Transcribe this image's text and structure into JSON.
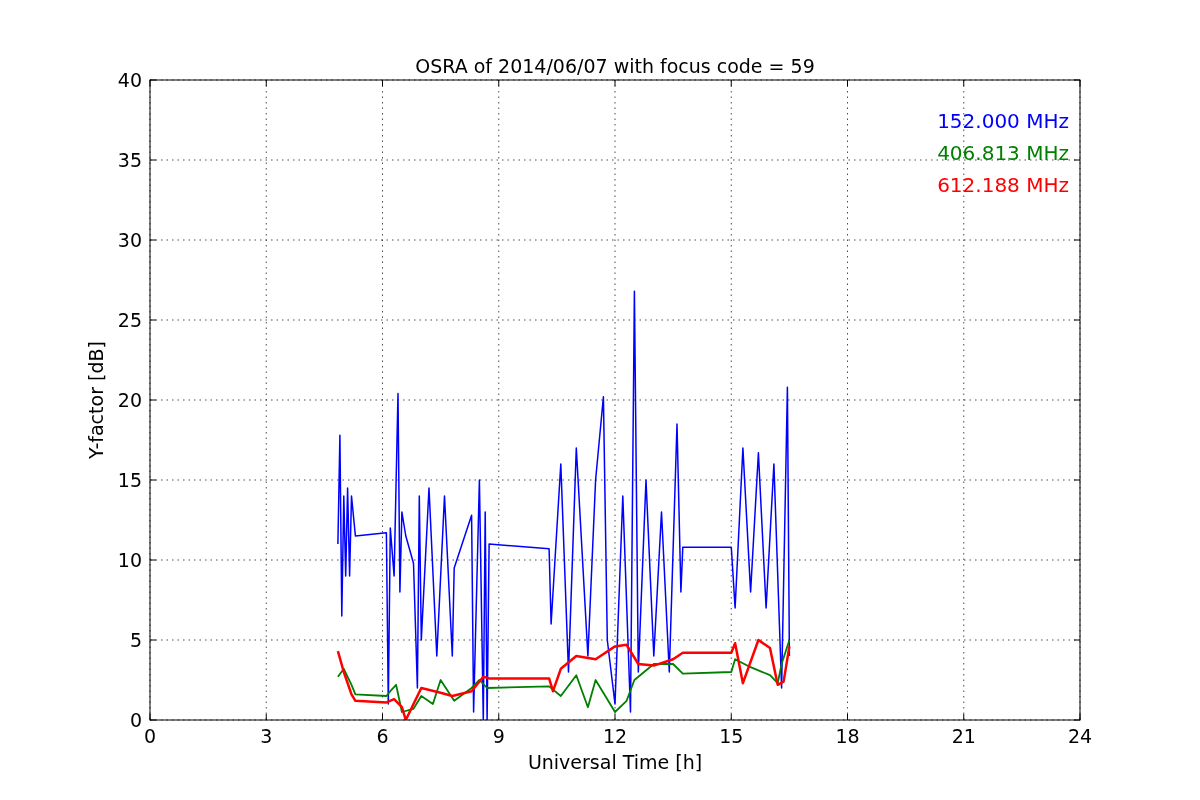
{
  "chart_data": {
    "type": "line",
    "title": "OSRA of 2014/06/07 with focus code = 59",
    "xlabel": "Universal Time [h]",
    "ylabel": "Y-factor [dB]",
    "grid": true,
    "xlim": [
      0,
      24
    ],
    "ylim": [
      0,
      40
    ],
    "xticks": [
      0,
      3,
      6,
      9,
      12,
      15,
      18,
      21,
      24
    ],
    "yticks": [
      0,
      5,
      10,
      15,
      20,
      25,
      30,
      35,
      40
    ],
    "series": [
      {
        "name": "152.000 MHz",
        "color": "#0000ff",
        "x": [
          4.85,
          4.9,
          4.95,
          5.0,
          5.05,
          5.1,
          5.15,
          5.2,
          5.3,
          6.1,
          6.15,
          6.2,
          6.3,
          6.4,
          6.45,
          6.5,
          6.6,
          6.8,
          6.9,
          6.95,
          7.0,
          7.2,
          7.4,
          7.6,
          7.8,
          7.85,
          8.3,
          8.35,
          8.5,
          8.6,
          8.65,
          8.7,
          8.75,
          10.3,
          10.35,
          10.6,
          10.8,
          11.0,
          11.3,
          11.5,
          11.7,
          11.8,
          12.0,
          12.2,
          12.4,
          12.5,
          12.6,
          12.8,
          13.0,
          13.2,
          13.4,
          13.6,
          13.7,
          13.75,
          15.0,
          15.1,
          15.3,
          15.5,
          15.7,
          15.9,
          16.1,
          16.3,
          16.45,
          16.5
        ],
        "values": [
          11,
          17.8,
          6.5,
          14,
          9,
          14.5,
          9,
          14,
          11.5,
          11.7,
          1,
          12,
          9,
          20.4,
          8,
          13,
          11.5,
          9.8,
          2,
          14,
          5,
          14.5,
          4,
          14,
          4,
          9.5,
          12.8,
          0.5,
          15,
          0,
          13,
          0,
          11,
          10.7,
          6,
          16,
          3,
          17,
          4,
          15,
          20.2,
          5,
          1,
          14,
          0.5,
          26.8,
          3,
          15,
          4,
          13,
          3,
          18.5,
          8,
          10.8,
          10.8,
          7,
          17,
          8,
          16.7,
          7,
          16,
          2,
          20.8,
          4
        ]
      },
      {
        "name": "406.813 MHz",
        "color": "#008000",
        "x": [
          4.85,
          5.0,
          5.2,
          5.3,
          6.1,
          6.2,
          6.35,
          6.5,
          6.8,
          7.0,
          7.3,
          7.5,
          7.85,
          8.3,
          8.5,
          8.7,
          10.3,
          10.6,
          11.0,
          11.3,
          11.5,
          12.0,
          12.3,
          12.5,
          13.0,
          13.5,
          13.75,
          15.0,
          15.1,
          15.5,
          16.0,
          16.2,
          16.3,
          16.5
        ],
        "values": [
          2.7,
          3.2,
          2.2,
          1.6,
          1.5,
          1.8,
          2.2,
          0.5,
          0.7,
          1.5,
          1.0,
          2.5,
          1.2,
          2.0,
          2.5,
          2.0,
          2.1,
          1.5,
          2.8,
          0.8,
          2.5,
          0.5,
          1.2,
          2.5,
          3.5,
          3.5,
          2.9,
          3.0,
          3.8,
          3.3,
          2.8,
          2.3,
          3.5,
          5
        ]
      },
      {
        "name": "612.188 MHz",
        "color": "#ff0000",
        "x": [
          4.85,
          5.0,
          5.2,
          5.3,
          6.1,
          6.3,
          6.5,
          6.6,
          6.8,
          7.0,
          7.5,
          7.8,
          8.3,
          8.6,
          8.75,
          10.3,
          10.4,
          10.6,
          11.0,
          11.5,
          12.0,
          12.3,
          12.6,
          13.0,
          13.5,
          13.75,
          15.0,
          15.1,
          15.3,
          15.7,
          16.0,
          16.2,
          16.35,
          16.5
        ],
        "values": [
          4.3,
          3.0,
          1.6,
          1.2,
          1.1,
          1.3,
          0.8,
          0,
          1.0,
          2.0,
          1.7,
          1.5,
          1.8,
          2.7,
          2.6,
          2.6,
          1.8,
          3.2,
          4.0,
          3.8,
          4.6,
          4.7,
          3.5,
          3.4,
          3.8,
          4.2,
          4.2,
          4.8,
          2.3,
          5.0,
          4.5,
          2.2,
          2.4,
          4.6
        ]
      }
    ]
  }
}
